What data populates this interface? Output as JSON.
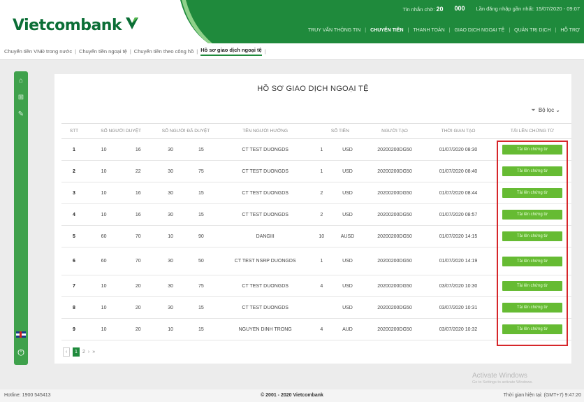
{
  "header": {
    "brand": "Vietcombank",
    "count_label": "Tin nhắn chờ:",
    "count_value": "20",
    "count_value2": "000",
    "last_login": "Lần đăng nhập gần nhất: 15/07/2020 - 09:07",
    "nav": [
      "TRUY VẤN THÔNG TIN",
      "CHUYỂN TIỀN",
      "THANH TOÁN",
      "GIAO DỊCH NGOẠI TỆ",
      "QUẢN TRỊ DỊCH",
      "HỖ TRỢ"
    ],
    "nav_active_index": 1
  },
  "subnav": {
    "items": [
      "Chuyển tiền VNĐ trong nước",
      "Chuyển tiền ngoại tệ",
      "Chuyển tiền theo công hồ",
      "Hồ sơ giao dịch ngoại tệ"
    ],
    "active_index": 3
  },
  "panel": {
    "title": "HỒ SƠ GIAO DỊCH NGOẠI TỆ",
    "filter_label": "Bộ lọc"
  },
  "table": {
    "columns": [
      "STT",
      "SỐ NGƯỜI DUYỆT",
      "SỐ NGƯỜI ĐÃ DUYỆT",
      "TÊN NGƯỜI HƯỞNG",
      "SỐ TIỀN",
      "NGƯỜI TẠO",
      "THỜI GIAN TẠO",
      "TẢI LÊN CHỨNG TỪ"
    ],
    "rows": [
      {
        "stt": "1",
        "a": "10",
        "b": "16",
        "c": "30",
        "d": "15",
        "name": "CT TEST DUONGDS",
        "amt_n": "1",
        "amt_c": "USD",
        "creator": "20200200DG50",
        "time": "01/07/2020 08:30"
      },
      {
        "stt": "2",
        "a": "10",
        "b": "22",
        "c": "30",
        "d": "75",
        "name": "CT TEST DUONGDS",
        "amt_n": "1",
        "amt_c": "USD",
        "creator": "20200200DG50",
        "time": "01/07/2020 08:40"
      },
      {
        "stt": "3",
        "a": "10",
        "b": "16",
        "c": "30",
        "d": "15",
        "name": "CT TEST DUONGDS",
        "amt_n": "2",
        "amt_c": "USD",
        "creator": "20200200DG50",
        "time": "01/07/2020 08:44"
      },
      {
        "stt": "4",
        "a": "10",
        "b": "16",
        "c": "30",
        "d": "15",
        "name": "CT TEST DUONGDS",
        "amt_n": "2",
        "amt_c": "USD",
        "creator": "20200200DG50",
        "time": "01/07/2020 08:57"
      },
      {
        "stt": "5",
        "a": "60",
        "b": "70",
        "c": "10",
        "d": "90",
        "name": "DANGIII",
        "amt_n": "10",
        "amt_c": "AUSD",
        "creator": "20200200DG50",
        "time": "01/07/2020 14:15"
      },
      {
        "stt": "6",
        "a": "60",
        "b": "70",
        "c": "30",
        "d": "50",
        "name": "CT TEST NSRP DUONGDS",
        "amt_n": "1",
        "amt_c": "USD",
        "creator": "20200200DG50",
        "time": "01/07/2020 14:19",
        "tall": true
      },
      {
        "stt": "7",
        "a": "10",
        "b": "20",
        "c": "30",
        "d": "75",
        "name": "CT TEST DUONGDS",
        "amt_n": "4",
        "amt_c": "USD",
        "creator": "20200200DG50",
        "time": "03/07/2020 10:30"
      },
      {
        "stt": "8",
        "a": "10",
        "b": "20",
        "c": "30",
        "d": "15",
        "name": "CT TEST DUONGDS",
        "amt_n": "",
        "amt_c": "USD",
        "creator": "20200200DG50",
        "time": "03/07/2020 10:31"
      },
      {
        "stt": "9",
        "a": "10",
        "b": "20",
        "c": "10",
        "d": "15",
        "name": "NGUYEN DINH TRONG",
        "amt_n": "4",
        "amt_c": "AUD",
        "creator": "20200200DG50",
        "time": "03/07/2020 10:32"
      }
    ],
    "upload_label": "Tải lên chứng từ"
  },
  "pager": {
    "prev": "‹",
    "pages": [
      "1",
      "2"
    ],
    "active": "1",
    "next": "›",
    "last": "»"
  },
  "watermark": {
    "line1": "Activate Windows",
    "line2": "Go to Settings to activate Windows."
  },
  "footer": {
    "hotline": "Hotline: 1900 545413",
    "copyright": "© 2001 - 2020 Vietcombank",
    "server_time": "Thời gian hiện tại: (GMT+7) 9:47:20"
  },
  "colors": {
    "brand_green": "#1f8a3c",
    "button_green": "#66bb33",
    "highlight_red": "#d6262a"
  }
}
